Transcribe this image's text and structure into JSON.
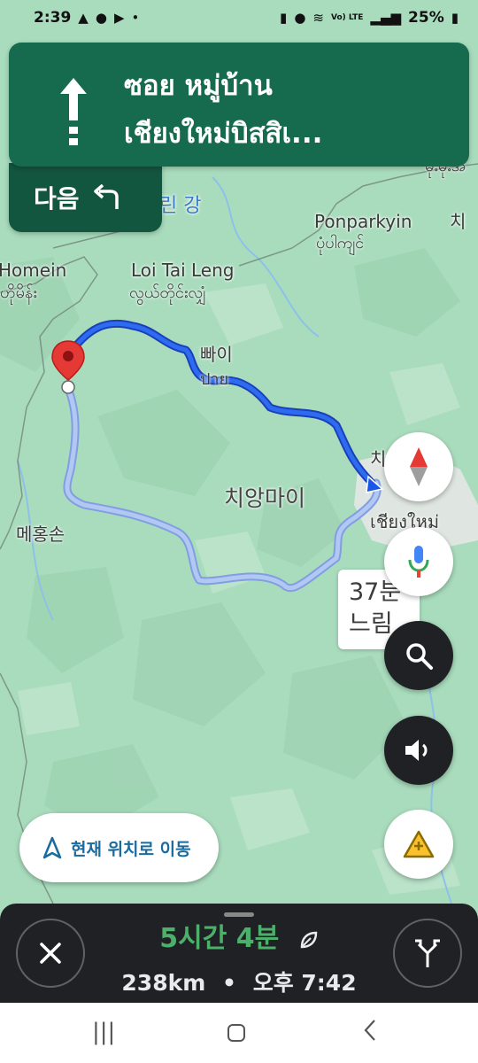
{
  "status_bar": {
    "time": "2:39",
    "battery": "25%",
    "volte": "Vo) LTE"
  },
  "direction": {
    "street_line1": "ซอย หมู่บ้าน",
    "street_line2": "เชียงใหม่บิสสิเ...",
    "next_label": "다음"
  },
  "map_labels": {
    "river": "린 강",
    "ponparkyin": "Ponparkyin",
    "ponparkyin_my": "ပုံပါကျင်",
    "chi_edge": "치",
    "chi_edge_my": "မိုးမိုးအ",
    "homein": "Homein",
    "homein_my": "ဟိုမိန်း",
    "loitaileng": "Loi Tai Leng",
    "loitaileng_my": "လွယ်တိုင်းလျှံ",
    "pai_ko": "빠이",
    "pai_th": "ปาย",
    "chiang_mai_ko": "치앙마이",
    "chiang_mai_th": "เชียงใหม่",
    "chi_right": "치",
    "mae_hong_son": "메홍손"
  },
  "delay_callout": {
    "line1": "37분",
    "line2": "느림"
  },
  "recenter": {
    "label": "현재 위치로 이동"
  },
  "trip": {
    "duration": "5시간 4분",
    "distance": "238km",
    "separator": "•",
    "eta": "오후 7:42"
  },
  "icons": {
    "compass": "compass-icon",
    "mic": "mic-icon",
    "search": "search-icon",
    "sound": "sound-icon",
    "report": "report-incident-icon",
    "close": "close-icon",
    "alternate_routes": "alt-routes-icon"
  },
  "colors": {
    "banner": "#166b4e",
    "route_active": "#1a57e8",
    "route_alt": "#9fb5ee",
    "trip_time": "#4caf6a"
  }
}
